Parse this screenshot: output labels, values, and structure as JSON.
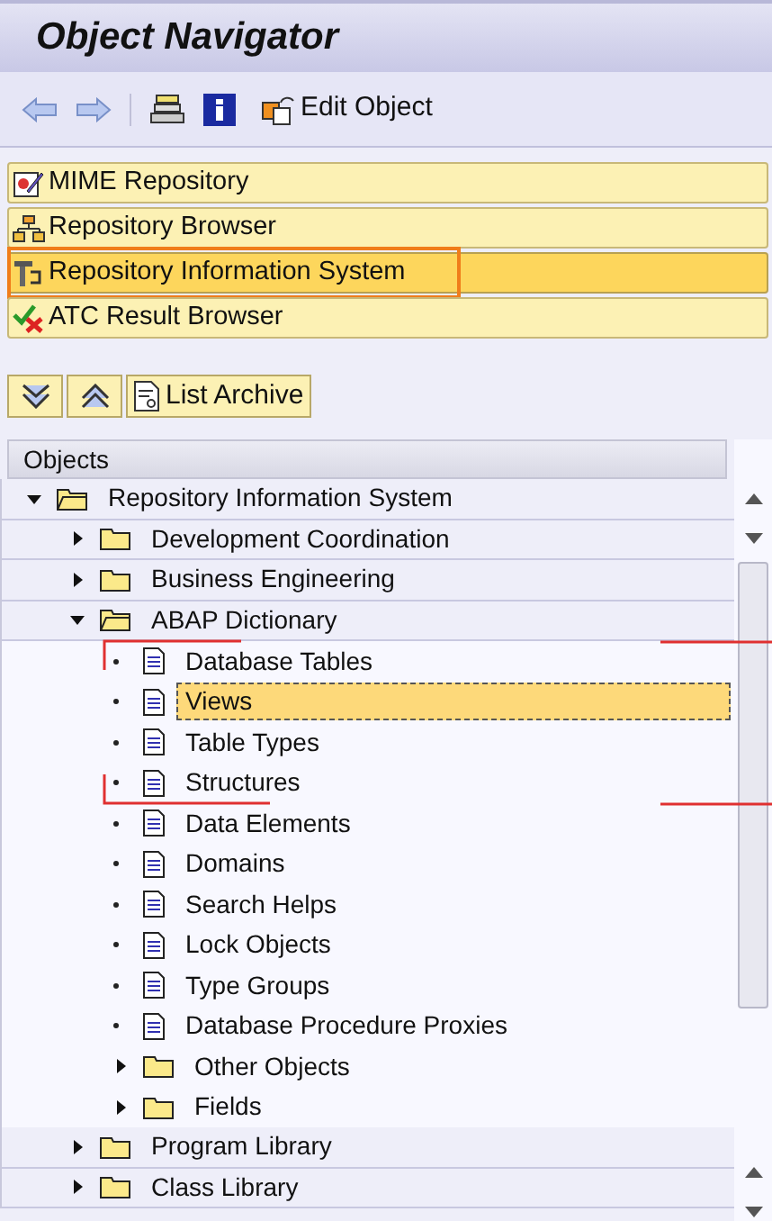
{
  "window": {
    "title": "Object Navigator"
  },
  "toolbar": {
    "edit_button": {
      "label": "Edit Object"
    }
  },
  "nav_buttons": [
    {
      "label": "MIME Repository",
      "selected": false,
      "kind": "mime"
    },
    {
      "label": "Repository Browser",
      "selected": false,
      "kind": "browser"
    },
    {
      "label": "Repository Information System",
      "selected": true,
      "kind": "infosys"
    },
    {
      "label": "ATC Result Browser",
      "selected": false,
      "kind": "atc"
    }
  ],
  "list_archive": {
    "label": "List Archive"
  },
  "tree": {
    "header": "Objects",
    "items": [
      {
        "label": "Repository Information System",
        "kind": "folder",
        "expanded": true,
        "selected": false,
        "children": [
          {
            "label": "Development Coordination",
            "kind": "folder",
            "expanded": false,
            "selected": false
          },
          {
            "label": "Business Engineering",
            "kind": "folder",
            "expanded": false,
            "selected": false
          },
          {
            "label": "ABAP Dictionary",
            "kind": "folder",
            "expanded": true,
            "selected": false,
            "children": [
              {
                "label": "Database Tables",
                "kind": "document",
                "selected": false
              },
              {
                "label": "Views",
                "kind": "document",
                "selected": true
              },
              {
                "label": "Table Types",
                "kind": "document",
                "selected": false
              },
              {
                "label": "Structures",
                "kind": "document",
                "selected": false
              },
              {
                "label": "Data Elements",
                "kind": "document",
                "selected": false
              },
              {
                "label": "Domains",
                "kind": "document",
                "selected": false
              },
              {
                "label": "Search Helps",
                "kind": "document",
                "selected": false
              },
              {
                "label": "Lock Objects",
                "kind": "document",
                "selected": false
              },
              {
                "label": "Type Groups",
                "kind": "document",
                "selected": false
              },
              {
                "label": "Database Procedure Proxies",
                "kind": "document",
                "selected": false
              },
              {
                "label": "Other Objects",
                "kind": "folder",
                "expanded": false,
                "selected": false
              },
              {
                "label": "Fields",
                "kind": "folder",
                "expanded": false,
                "selected": false
              }
            ]
          },
          {
            "label": "Program Library",
            "kind": "folder",
            "expanded": false,
            "selected": false
          },
          {
            "label": "Class Library",
            "kind": "folder",
            "expanded": false,
            "selected": false
          }
        ]
      }
    ]
  }
}
